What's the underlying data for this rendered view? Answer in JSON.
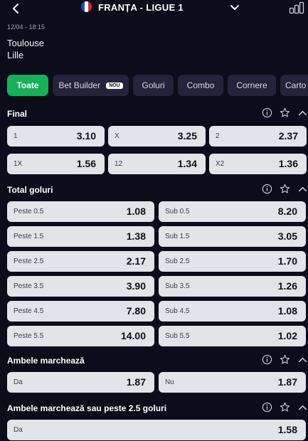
{
  "header": {
    "back_icon": "chevron-left-icon",
    "flag_icon": "france-flag-icon",
    "flag_colors": [
      "#1e4fc2",
      "#ffffff",
      "#e0243a"
    ],
    "league": "FRANȚA - LIGUE 1",
    "dropdown_icon": "chevron-down-icon",
    "stats_icon": "bar-chart-icon"
  },
  "match": {
    "date": "12/04 - 18:15",
    "home": "Toulouse",
    "away": "Lille"
  },
  "tabs": [
    {
      "label": "Toate",
      "active": true
    },
    {
      "label": "Bet Builder",
      "badge": "NOU"
    },
    {
      "label": "Goluri"
    },
    {
      "label": "Combo"
    },
    {
      "label": "Cornere"
    },
    {
      "label": "Carto"
    }
  ],
  "colors": {
    "background": "#0d0c1b",
    "active_tab": "#17b15a",
    "tab": "#24233a",
    "odd_button": "#e3e3ea"
  },
  "section_icons": [
    "info-icon",
    "star-icon",
    "chevron-up-icon"
  ],
  "sections": {
    "final": {
      "title": "Final",
      "odds": [
        {
          "label": "1",
          "value": "3.10"
        },
        {
          "label": "X",
          "value": "3.25"
        },
        {
          "label": "2",
          "value": "2.37"
        },
        {
          "label": "1X",
          "value": "1.56"
        },
        {
          "label": "12",
          "value": "1.34"
        },
        {
          "label": "X2",
          "value": "1.36"
        }
      ]
    },
    "total_goals": {
      "title": "Total goluri",
      "odds": [
        {
          "label": "Peste 0.5",
          "value": "1.08"
        },
        {
          "label": "Sub 0.5",
          "value": "8.20"
        },
        {
          "label": "Peste 1.5",
          "value": "1.38"
        },
        {
          "label": "Sub 1.5",
          "value": "3.05"
        },
        {
          "label": "Peste 2.5",
          "value": "2.17"
        },
        {
          "label": "Sub 2.5",
          "value": "1.70"
        },
        {
          "label": "Peste 3.5",
          "value": "3.90"
        },
        {
          "label": "Sub 3.5",
          "value": "1.26"
        },
        {
          "label": "Peste 4.5",
          "value": "7.80"
        },
        {
          "label": "Sub 4.5",
          "value": "1.08"
        },
        {
          "label": "Peste 5.5",
          "value": "14.00"
        },
        {
          "label": "Sub 5.5",
          "value": "1.02"
        }
      ]
    },
    "btts": {
      "title": "Ambele marchează",
      "odds": [
        {
          "label": "Da",
          "value": "1.87"
        },
        {
          "label": "Nu",
          "value": "1.87"
        }
      ]
    },
    "btts_over": {
      "title": "Ambele marchează sau peste 2.5 goluri",
      "odds": [
        {
          "label": "Da",
          "value": "1.58"
        }
      ]
    }
  }
}
